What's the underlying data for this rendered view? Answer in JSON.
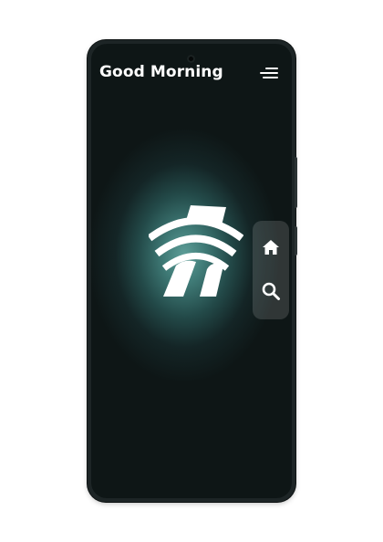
{
  "header": {
    "greeting": "Good Morning",
    "menu_icon": "hamburger-menu-icon"
  },
  "main": {
    "logo_icon": "house-signal-logo-icon"
  },
  "side_dock": {
    "items": [
      {
        "icon": "home-icon"
      },
      {
        "icon": "search-icon"
      }
    ]
  },
  "colors": {
    "screen_glow": "#5e9e98",
    "screen_dark": "#0e1616",
    "device_frame": "#1d2526",
    "text": "#ffffff",
    "dock_background": "rgba(255,255,255,0.14)"
  }
}
